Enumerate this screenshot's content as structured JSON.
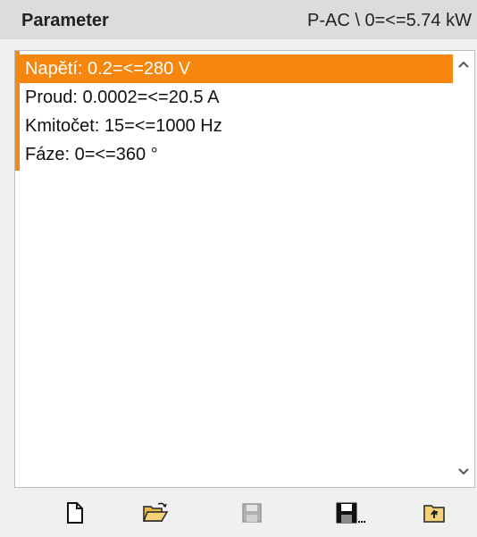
{
  "header": {
    "title": "Parameter",
    "info": "P-AC \\ 0=<=5.74 kW"
  },
  "list": {
    "items": [
      {
        "label": "Napětí: 0.2=<=280 V",
        "selected": true
      },
      {
        "label": "Proud: 0.0002=<=20.5 A",
        "selected": false
      },
      {
        "label": "Kmitočet: 15=<=1000 Hz",
        "selected": false
      },
      {
        "label": "Fáze: 0=<=360 °",
        "selected": false
      }
    ]
  },
  "scrollbar": {
    "up_icon": "chevron-up-icon",
    "down_icon": "chevron-down-icon"
  },
  "toolbar": {
    "buttons": [
      {
        "icon": "new-document-icon",
        "enabled": true
      },
      {
        "icon": "open-folder-icon",
        "enabled": true
      },
      {
        "icon": "save-icon",
        "enabled": false
      },
      {
        "icon": "save-as-icon",
        "enabled": true
      },
      {
        "icon": "folder-up-icon",
        "enabled": true
      }
    ]
  },
  "colors": {
    "accent": "#f7860f",
    "header_bg": "#dcdcdc",
    "panel_bg": "#f0f0f0"
  }
}
